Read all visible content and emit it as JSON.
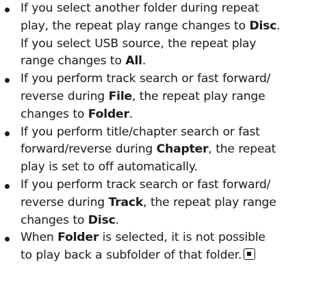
{
  "bullets": [
    {
      "lines": [
        [
          "If you select another folder during repeat"
        ],
        [
          "play, the repeat play range changes to ",
          {
            "b": "Disc"
          },
          "."
        ],
        [
          "If you select USB source, the repeat play"
        ],
        [
          "range changes to ",
          {
            "b": "All"
          },
          "."
        ]
      ]
    },
    {
      "lines": [
        [
          "If you perform track search or fast forward/"
        ],
        [
          "reverse during ",
          {
            "b": "File"
          },
          ", the repeat play range"
        ],
        [
          "changes to ",
          {
            "b": "Folder"
          },
          "."
        ]
      ]
    },
    {
      "lines": [
        [
          "If you perform title/chapter search or fast"
        ],
        [
          "forward/reverse during ",
          {
            "b": "Chapter"
          },
          ", the repeat"
        ],
        [
          "play is set to off automatically."
        ]
      ]
    },
    {
      "lines": [
        [
          "If you perform track search or fast forward/"
        ],
        [
          "reverse during ",
          {
            "b": "Track"
          },
          ", the repeat play range"
        ],
        [
          "changes to ",
          {
            "b": "Disc"
          },
          "."
        ]
      ]
    },
    {
      "lines": [
        [
          "When ",
          {
            "b": "Folder"
          },
          " is selected, it is not possible"
        ],
        [
          "to play back a subfolder of that folder."
        ]
      ],
      "end_mark": "end-of-section-icon"
    }
  ]
}
